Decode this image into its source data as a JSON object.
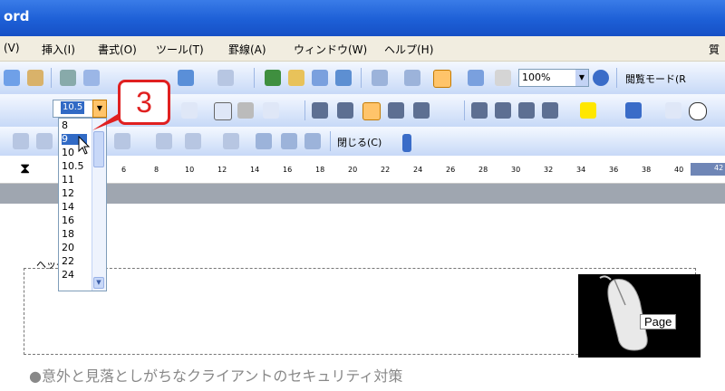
{
  "window": {
    "title": "ord"
  },
  "menu": {
    "items": [
      "(V)",
      "挿入(I)",
      "書式(O)",
      "ツール(T)",
      "罫線(A)",
      "ウィンドウ(W)",
      "ヘルプ(H)"
    ],
    "question": "質"
  },
  "toolbar": {
    "zoom_value": "100%",
    "read_mode_label": "閲覧モード(R",
    "close_label": "閉じる(C)"
  },
  "font_size": {
    "current": "10.5",
    "options": [
      "8",
      "9",
      "10",
      "10.5",
      "11",
      "12",
      "14",
      "16",
      "18",
      "20",
      "22",
      "24"
    ]
  },
  "callout": {
    "step": "3"
  },
  "ruler": {
    "ticks": [
      "6",
      "8",
      "10",
      "12",
      "14",
      "16",
      "18",
      "20",
      "22",
      "24",
      "26",
      "28",
      "30",
      "32",
      "34",
      "36",
      "38",
      "40",
      "42"
    ]
  },
  "document": {
    "header_tab": "ヘッダー",
    "page_label": "Page"
  },
  "caption": "●意外と見落としがちなクライアントのセキュリティ対策",
  "colors": {
    "titlebar": "#1d5fd6",
    "callout": "#e02020",
    "highlight": "#316ac5"
  }
}
